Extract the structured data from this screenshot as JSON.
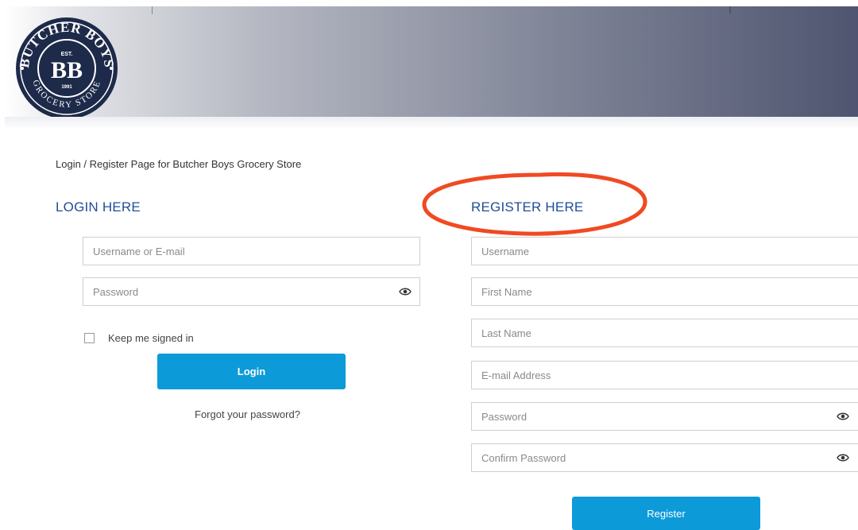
{
  "header": {
    "logo": {
      "top_text": "BUTCHER BOYS",
      "est_text": "EST.",
      "monogram": "BB",
      "year_text": "1991",
      "bottom_text": "GROCERY STORE",
      "colors": {
        "badge": "#1e2a4a",
        "text": "#ffffff"
      }
    }
  },
  "page": {
    "intro": "Login / Register Page for Butcher Boys Grocery Store"
  },
  "login": {
    "title": "LOGIN HERE",
    "username_placeholder": "Username or E-mail",
    "password_placeholder": "Password",
    "password_icon": "eye-icon",
    "remember_label": "Keep me signed in",
    "remember_checked": false,
    "button_label": "Login",
    "forgot_link": "Forgot your password?"
  },
  "register": {
    "title": "REGISTER HERE",
    "username_placeholder": "Username",
    "first_name_placeholder": "First Name",
    "last_name_placeholder": "Last Name",
    "email_placeholder": "E-mail Address",
    "password_placeholder": "Password",
    "confirm_password_placeholder": "Confirm Password",
    "password_icon": "eye-icon",
    "button_label": "Register"
  },
  "colors": {
    "accent_button": "#0d9ad8",
    "title_blue": "#1f4e96",
    "annotation_circle": "#f04a23"
  }
}
